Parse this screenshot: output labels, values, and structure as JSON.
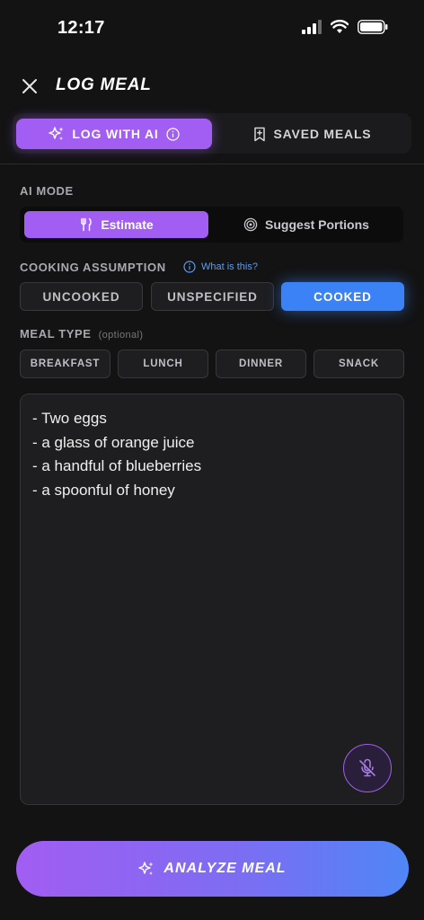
{
  "status": {
    "time": "12:17"
  },
  "header": {
    "title": "LOG MEAL",
    "close_icon": "close-icon"
  },
  "tabs": [
    {
      "label": "LOG WITH AI",
      "icon": "sparkle-icon",
      "info_icon": "info-icon",
      "active": true
    },
    {
      "label": "SAVED MEALS",
      "icon": "bookmark-plus-icon",
      "active": false
    }
  ],
  "ai_mode": {
    "label": "AI MODE",
    "options": [
      {
        "label": "Estimate",
        "icon": "utensils-icon",
        "active": true
      },
      {
        "label": "Suggest Portions",
        "icon": "target-icon",
        "active": false
      }
    ]
  },
  "cooking": {
    "label": "COOKING ASSUMPTION",
    "help_text": "What is this?",
    "options": [
      {
        "label": "UNCOOKED",
        "active": false
      },
      {
        "label": "UNSPECIFIED",
        "active": false
      },
      {
        "label": "COOKED",
        "active": true
      }
    ]
  },
  "meal_type": {
    "label": "MEAL TYPE",
    "optional": "(optional)",
    "options": [
      {
        "label": "BREAKFAST"
      },
      {
        "label": "LUNCH"
      },
      {
        "label": "DINNER"
      },
      {
        "label": "SNACK"
      }
    ]
  },
  "meal_input": {
    "lines": [
      "- Two eggs",
      "- a glass of orange juice",
      "- a handful of blueberries",
      "- a spoonful of honey"
    ],
    "mic_icon": "mic-off-icon"
  },
  "analyze": {
    "label": "ANALYZE MEAL",
    "icon": "sparkle-icon"
  },
  "colors": {
    "accent_purple": "#a25df2",
    "accent_blue": "#3b82f6",
    "background": "#131313"
  }
}
